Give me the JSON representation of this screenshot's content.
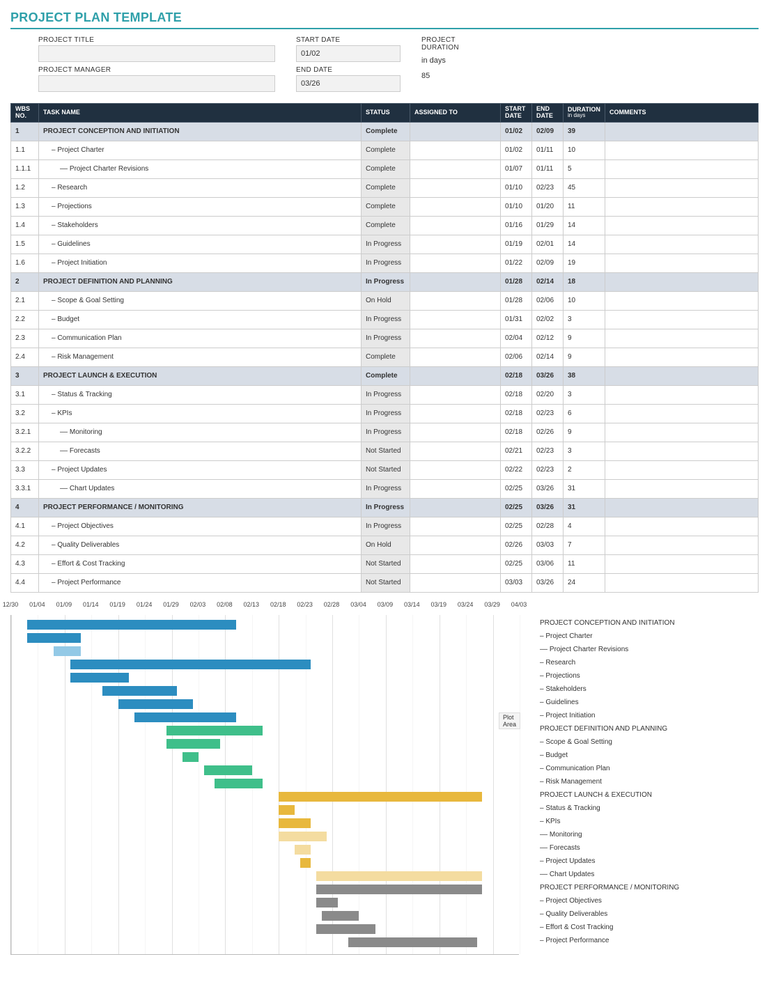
{
  "title": "PROJECT PLAN TEMPLATE",
  "header": {
    "project_title_label": "PROJECT TITLE",
    "project_title": "",
    "project_manager_label": "PROJECT MANAGER",
    "project_manager": "",
    "start_date_label": "START DATE",
    "start_date": "01/02",
    "end_date_label": "END DATE",
    "end_date": "03/26",
    "project_duration_label": "PROJECT DURATION",
    "in_days_label": "in days",
    "project_duration": "85"
  },
  "columns": {
    "wbs": "WBS NO.",
    "task": "TASK NAME",
    "status": "STATUS",
    "assigned": "ASSIGNED TO",
    "start": "START DATE",
    "end": "END DATE",
    "duration": "DURATION",
    "duration_sub": "in days",
    "comments": "COMMENTS"
  },
  "rows": [
    {
      "wbs": "1",
      "name": "PROJECT CONCEPTION AND INITIATION",
      "status": "Complete",
      "assigned": "",
      "start": "01/02",
      "end": "02/09",
      "dur": "39",
      "section": true,
      "level": 0
    },
    {
      "wbs": "1.1",
      "name": "– Project Charter",
      "status": "Complete",
      "assigned": "",
      "start": "01/02",
      "end": "01/11",
      "dur": "10",
      "level": 1
    },
    {
      "wbs": "1.1.1",
      "name": "–– Project Charter Revisions",
      "status": "Complete",
      "assigned": "",
      "start": "01/07",
      "end": "01/11",
      "dur": "5",
      "level": 2
    },
    {
      "wbs": "1.2",
      "name": "– Research",
      "status": "Complete",
      "assigned": "",
      "start": "01/10",
      "end": "02/23",
      "dur": "45",
      "level": 1
    },
    {
      "wbs": "1.3",
      "name": "– Projections",
      "status": "Complete",
      "assigned": "",
      "start": "01/10",
      "end": "01/20",
      "dur": "11",
      "level": 1
    },
    {
      "wbs": "1.4",
      "name": "– Stakeholders",
      "status": "Complete",
      "assigned": "",
      "start": "01/16",
      "end": "01/29",
      "dur": "14",
      "level": 1
    },
    {
      "wbs": "1.5",
      "name": "– Guidelines",
      "status": "In Progress",
      "assigned": "",
      "start": "01/19",
      "end": "02/01",
      "dur": "14",
      "level": 1
    },
    {
      "wbs": "1.6",
      "name": "– Project Initiation",
      "status": "In Progress",
      "assigned": "",
      "start": "01/22",
      "end": "02/09",
      "dur": "19",
      "level": 1
    },
    {
      "wbs": "2",
      "name": "PROJECT DEFINITION AND PLANNING",
      "status": "In Progress",
      "assigned": "",
      "start": "01/28",
      "end": "02/14",
      "dur": "18",
      "section": true,
      "level": 0
    },
    {
      "wbs": "2.1",
      "name": "– Scope & Goal Setting",
      "status": "On Hold",
      "assigned": "",
      "start": "01/28",
      "end": "02/06",
      "dur": "10",
      "level": 1
    },
    {
      "wbs": "2.2",
      "name": "– Budget",
      "status": "In Progress",
      "assigned": "",
      "start": "01/31",
      "end": "02/02",
      "dur": "3",
      "level": 1
    },
    {
      "wbs": "2.3",
      "name": "– Communication Plan",
      "status": "In Progress",
      "assigned": "",
      "start": "02/04",
      "end": "02/12",
      "dur": "9",
      "level": 1
    },
    {
      "wbs": "2.4",
      "name": "– Risk Management",
      "status": "Complete",
      "assigned": "",
      "start": "02/06",
      "end": "02/14",
      "dur": "9",
      "level": 1
    },
    {
      "wbs": "3",
      "name": "PROJECT LAUNCH & EXECUTION",
      "status": "Complete",
      "assigned": "",
      "start": "02/18",
      "end": "03/26",
      "dur": "38",
      "section": true,
      "level": 0
    },
    {
      "wbs": "3.1",
      "name": "– Status & Tracking",
      "status": "In Progress",
      "assigned": "",
      "start": "02/18",
      "end": "02/20",
      "dur": "3",
      "level": 1
    },
    {
      "wbs": "3.2",
      "name": "– KPIs",
      "status": "In Progress",
      "assigned": "",
      "start": "02/18",
      "end": "02/23",
      "dur": "6",
      "level": 1
    },
    {
      "wbs": "3.2.1",
      "name": "–– Monitoring",
      "status": "In Progress",
      "assigned": "",
      "start": "02/18",
      "end": "02/26",
      "dur": "9",
      "level": 2
    },
    {
      "wbs": "3.2.2",
      "name": "–– Forecasts",
      "status": "Not Started",
      "assigned": "",
      "start": "02/21",
      "end": "02/23",
      "dur": "3",
      "level": 2
    },
    {
      "wbs": "3.3",
      "name": "– Project Updates",
      "status": "Not Started",
      "assigned": "",
      "start": "02/22",
      "end": "02/23",
      "dur": "2",
      "level": 1
    },
    {
      "wbs": "3.3.1",
      "name": "–– Chart Updates",
      "status": "In Progress",
      "assigned": "",
      "start": "02/25",
      "end": "03/26",
      "dur": "31",
      "level": 2
    },
    {
      "wbs": "4",
      "name": "PROJECT PERFORMANCE / MONITORING",
      "status": "In Progress",
      "assigned": "",
      "start": "02/25",
      "end": "03/26",
      "dur": "31",
      "section": true,
      "level": 0
    },
    {
      "wbs": "4.1",
      "name": "– Project Objectives",
      "status": "In Progress",
      "assigned": "",
      "start": "02/25",
      "end": "02/28",
      "dur": "4",
      "level": 1
    },
    {
      "wbs": "4.2",
      "name": "– Quality Deliverables",
      "status": "On Hold",
      "assigned": "",
      "start": "02/26",
      "end": "03/03",
      "dur": "7",
      "level": 1
    },
    {
      "wbs": "4.3",
      "name": "– Effort & Cost Tracking",
      "status": "Not Started",
      "assigned": "",
      "start": "02/25",
      "end": "03/06",
      "dur": "11",
      "level": 1
    },
    {
      "wbs": "4.4",
      "name": "– Project Performance",
      "status": "Not Started",
      "assigned": "",
      "start": "03/03",
      "end": "03/26",
      "dur": "24",
      "level": 1
    }
  ],
  "chart_data": {
    "type": "bar",
    "orientation": "horizontal-gantt",
    "plot_area_label": "Plot Area",
    "x_axis_origin": "12/30",
    "x_axis_ticks": [
      "12/30",
      "01/04",
      "01/09",
      "01/14",
      "01/19",
      "01/24",
      "01/29",
      "02/03",
      "02/08",
      "02/13",
      "02/18",
      "02/23",
      "02/28",
      "03/04",
      "03/09",
      "03/14",
      "03/19",
      "03/24",
      "03/29",
      "04/03"
    ],
    "colors": {
      "group1": "#2c8dc0",
      "group1_light": "#93c9e6",
      "group2": "#3fbf8a",
      "group2_light": "#9fe0c6",
      "group3": "#e8b83d",
      "group3_light": "#f4dca0",
      "group4": "#8a8a8a",
      "group4_light": "#c6c6c6"
    },
    "series": [
      {
        "name": "PROJECT CONCEPTION AND INITIATION",
        "start": 3,
        "dur": 39,
        "color": "c0"
      },
      {
        "name": "– Project Charter",
        "start": 3,
        "dur": 10,
        "color": "c0"
      },
      {
        "name": "–– Project Charter Revisions",
        "start": 8,
        "dur": 5,
        "color": "c0l"
      },
      {
        "name": "– Research",
        "start": 11,
        "dur": 45,
        "color": "c0"
      },
      {
        "name": "– Projections",
        "start": 11,
        "dur": 11,
        "color": "c0"
      },
      {
        "name": "– Stakeholders",
        "start": 17,
        "dur": 14,
        "color": "c0"
      },
      {
        "name": "– Guidelines",
        "start": 20,
        "dur": 14,
        "color": "c0"
      },
      {
        "name": "– Project Initiation",
        "start": 23,
        "dur": 19,
        "color": "c0"
      },
      {
        "name": "PROJECT DEFINITION AND PLANNING",
        "start": 29,
        "dur": 18,
        "color": "c1"
      },
      {
        "name": "– Scope & Goal Setting",
        "start": 29,
        "dur": 10,
        "color": "c1"
      },
      {
        "name": "– Budget",
        "start": 32,
        "dur": 3,
        "color": "c1"
      },
      {
        "name": "– Communication Plan",
        "start": 36,
        "dur": 9,
        "color": "c1"
      },
      {
        "name": "– Risk Management",
        "start": 38,
        "dur": 9,
        "color": "c1"
      },
      {
        "name": "PROJECT LAUNCH & EXECUTION",
        "start": 50,
        "dur": 38,
        "color": "c2"
      },
      {
        "name": "– Status & Tracking",
        "start": 50,
        "dur": 3,
        "color": "c2"
      },
      {
        "name": "– KPIs",
        "start": 50,
        "dur": 6,
        "color": "c2"
      },
      {
        "name": "–– Monitoring",
        "start": 50,
        "dur": 9,
        "color": "c2l"
      },
      {
        "name": "–– Forecasts",
        "start": 53,
        "dur": 3,
        "color": "c2l"
      },
      {
        "name": "– Project Updates",
        "start": 54,
        "dur": 2,
        "color": "c2"
      },
      {
        "name": "–– Chart Updates",
        "start": 57,
        "dur": 31,
        "color": "c2l"
      },
      {
        "name": "PROJECT PERFORMANCE / MONITORING",
        "start": 57,
        "dur": 31,
        "color": "c3"
      },
      {
        "name": "– Project Objectives",
        "start": 57,
        "dur": 4,
        "color": "c3"
      },
      {
        "name": "– Quality Deliverables",
        "start": 58,
        "dur": 7,
        "color": "c3"
      },
      {
        "name": "– Effort & Cost Tracking",
        "start": 57,
        "dur": 11,
        "color": "c3"
      },
      {
        "name": "– Project Performance",
        "start": 63,
        "dur": 24,
        "color": "c3"
      }
    ],
    "total_days": 95
  }
}
